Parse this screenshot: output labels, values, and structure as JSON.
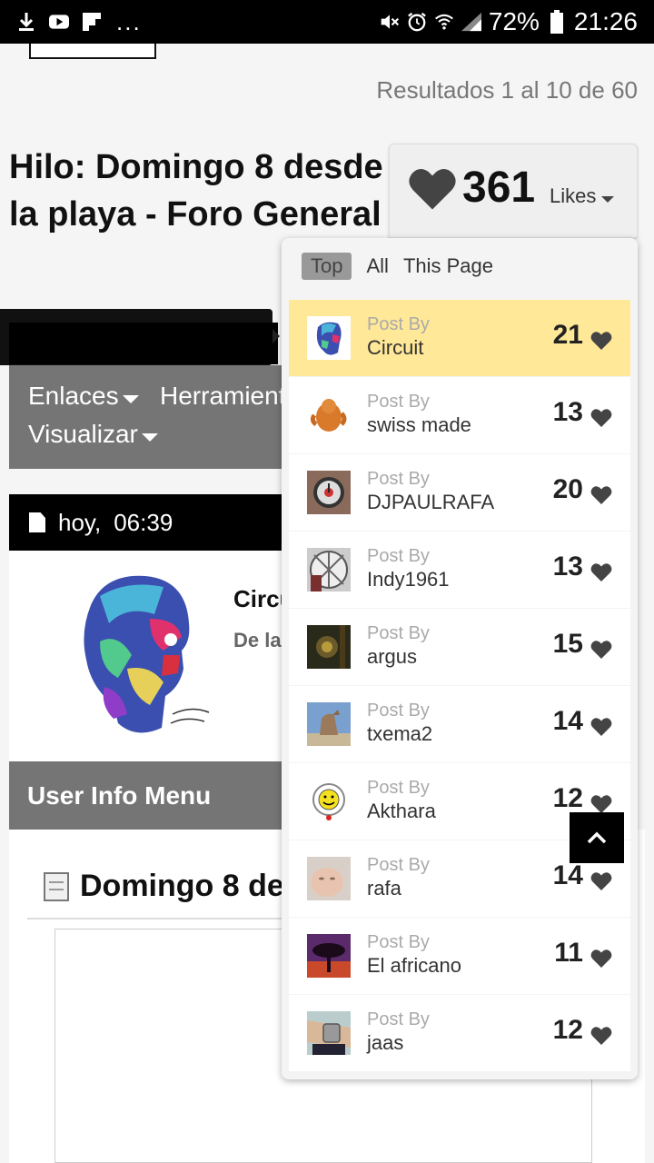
{
  "status_bar": {
    "dots": "...",
    "battery": "72%",
    "time": "21:26",
    "icons": [
      "download-icon",
      "youtube-icon",
      "flipboard-icon",
      "mute-icon",
      "alarm-icon",
      "wifi-icon",
      "signal-icon",
      "battery-icon"
    ]
  },
  "page": {
    "results_text": "Resultados 1 al 10 de 60",
    "thread_title": "Hilo: Domingo 8 desde la playa - Foro General",
    "menu": {
      "enlaces": "Enlaces",
      "herramientas": "Herramient",
      "visualizar": "Visualizar"
    },
    "post_date": "hoy,",
    "post_time": "06:39",
    "author_partial": "Circu",
    "author_sub_partial": "De la",
    "user_info_menu": "User Info Menu",
    "post_title_partial": "Domingo 8 de"
  },
  "likes": {
    "count": "361",
    "label": "Likes",
    "tabs": [
      "Top",
      "All",
      "This Page"
    ],
    "post_by_label": "Post By",
    "rows": [
      {
        "user": "Circuit",
        "count": "21",
        "highlight": true,
        "thumb": "head"
      },
      {
        "user": "swiss made",
        "count": "13",
        "highlight": false,
        "thumb": "thing"
      },
      {
        "user": "DJPAULRAFA",
        "count": "20",
        "highlight": false,
        "thumb": "watch"
      },
      {
        "user": "Indy1961",
        "count": "13",
        "highlight": false,
        "thumb": "clock"
      },
      {
        "user": "argus",
        "count": "15",
        "highlight": false,
        "thumb": "dark"
      },
      {
        "user": "txema2",
        "count": "14",
        "highlight": false,
        "thumb": "horse"
      },
      {
        "user": "Akthara",
        "count": "12",
        "highlight": false,
        "thumb": "smiley"
      },
      {
        "user": "rafa",
        "count": "14",
        "highlight": false,
        "thumb": "baby"
      },
      {
        "user": "El africano",
        "count": "11",
        "highlight": false,
        "thumb": "tree"
      },
      {
        "user": "jaas",
        "count": "12",
        "highlight": false,
        "thumb": "wrist"
      }
    ]
  },
  "colors": {
    "highlight": "#ffe898",
    "menu_grey": "#757575",
    "heart": "#444444"
  }
}
